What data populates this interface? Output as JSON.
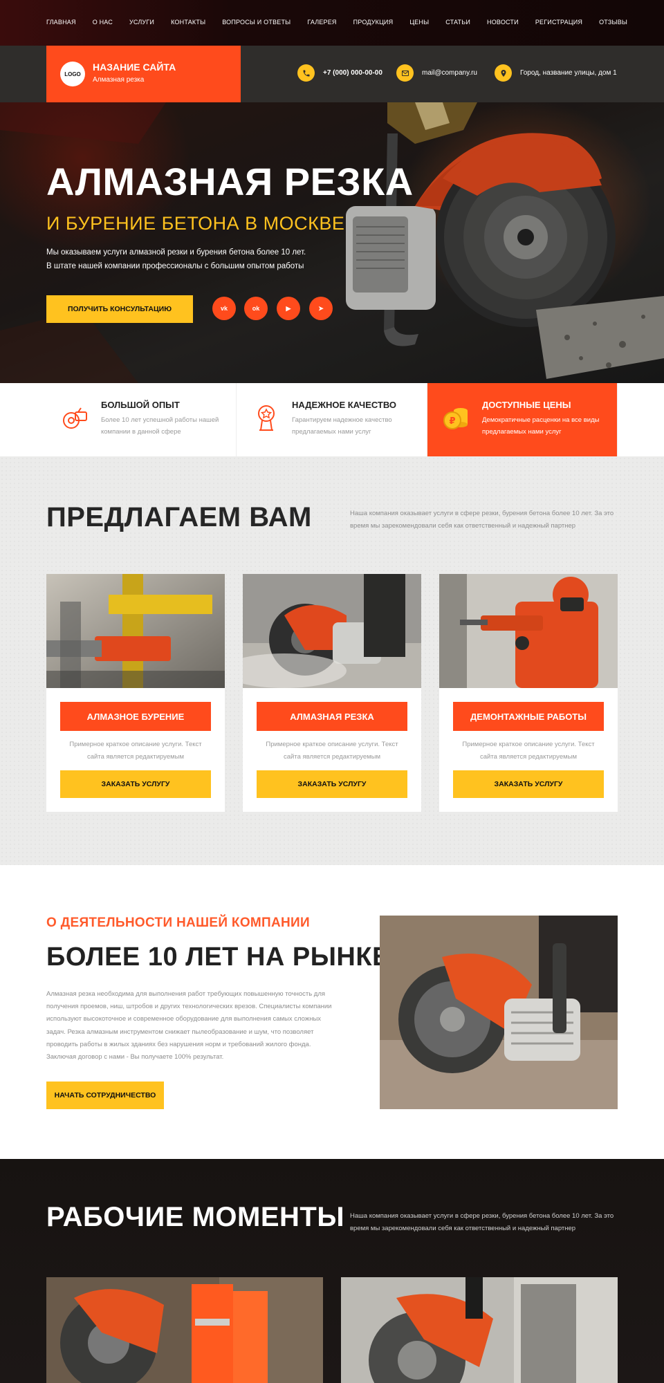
{
  "nav": [
    "Главная",
    "О нас",
    "Услуги",
    "Контакты",
    "Вопросы и ответы",
    "Галерея",
    "Продукция",
    "Цены",
    "Статьи",
    "Новости",
    "Регистрация",
    "Отзывы"
  ],
  "header": {
    "logo_text": "LOGO",
    "site_name": "НАЗАНИЕ САЙТА",
    "site_sub": "Алмазная резка",
    "phone": "+7 (000) 000-00-00",
    "email": "mail@company.ru",
    "address": "Город, название улицы, дом 1"
  },
  "hero": {
    "title": "АЛМАЗНАЯ РЕЗКА",
    "subtitle": "И БУРЕНИЕ БЕТОНА В МОСКВЕ",
    "text_line1": "Мы оказываем услуги алмазной резки и бурения бетона более 10 лет.",
    "text_line2": "В штате нашей компании профессионалы с большим опытом работы",
    "cta": "ПОЛУЧИТЬ КОНСУЛЬТАЦИЮ",
    "social": [
      {
        "icon": "vk-icon",
        "glyph": "vk"
      },
      {
        "icon": "odnoklassniki-icon",
        "glyph": "ok"
      },
      {
        "icon": "youtube-icon",
        "glyph": "▶"
      },
      {
        "icon": "telegram-icon",
        "glyph": "➤"
      }
    ]
  },
  "features": [
    {
      "icon": "saw-icon",
      "title": "БОЛЬШОЙ ОПЫТ",
      "text": "Более 10 лет успешной работы нашей компании в данной сфере"
    },
    {
      "icon": "award-icon",
      "title": "НАДЕЖНОЕ КАЧЕСТВО",
      "text": "Гарантируем надежное качество предлагаемых нами услуг"
    },
    {
      "icon": "coins-icon",
      "title": "ДОСТУПНЫЕ ЦЕНЫ",
      "text": "Демократичные расценки на все виды предлагаемых нами услуг"
    }
  ],
  "offer": {
    "title": "ПРЕДЛАГАЕМ ВАМ",
    "desc": "Наша компания оказывает  услуги в сфере резки, бурения бетона более 10 лет. За это время мы зарекомендовали себя как ответственный и надежный партнер",
    "cards": [
      {
        "label": "АЛМАЗНОЕ БУРЕНИЕ",
        "desc": "Примерное краткое описание услуги. Текст сайта является редактируемым",
        "button": "ЗАКАЗАТЬ УСЛУГУ"
      },
      {
        "label": "АЛМАЗНАЯ РЕЗКА",
        "desc": "Примерное краткое описание услуги. Текст сайта является редактируемым",
        "button": "ЗАКАЗАТЬ УСЛУГУ"
      },
      {
        "label": "ДЕМОНТАЖНЫЕ РАБОТЫ",
        "desc": "Примерное краткое описание услуги. Текст сайта является редактируемым",
        "button": "ЗАКАЗАТЬ УСЛУГУ"
      }
    ]
  },
  "about": {
    "kicker": "О ДЕЯТЕЛЬНОСТИ НАШЕЙ КОМПАНИИ",
    "title": "БОЛЕЕ 10 ЛЕТ НА РЫНКЕ",
    "text": "Алмазная резка необходима для выполнения работ требующих повышенную точность для получения проемов, ниш, штробов и других технологических врезов. Специалисты компании используют высокоточное и современное оборудование для выполнения самых сложных задач. Резка алмазным инструментом снижает пылеобразование и шум, что позволяет проводить работы в жилых зданиях без нарушения норм и требований жилого фонда. Заключая договор с нами - Вы получаете 100% результат.",
    "cta": "НАЧАТЬ СОТРУДНИЧЕСТВО"
  },
  "moments": {
    "title": "РАБОЧИЕ МОМЕНТЫ",
    "desc": "Наша компания оказывает  услуги в сфере резки, бурения бетона более 10 лет.  За это время мы зарекомендовали себя как ответственный и надежный партнер"
  },
  "colors": {
    "accent": "#ff4b1c",
    "yellow": "#ffc21f",
    "dark": "#2f2d2b"
  }
}
